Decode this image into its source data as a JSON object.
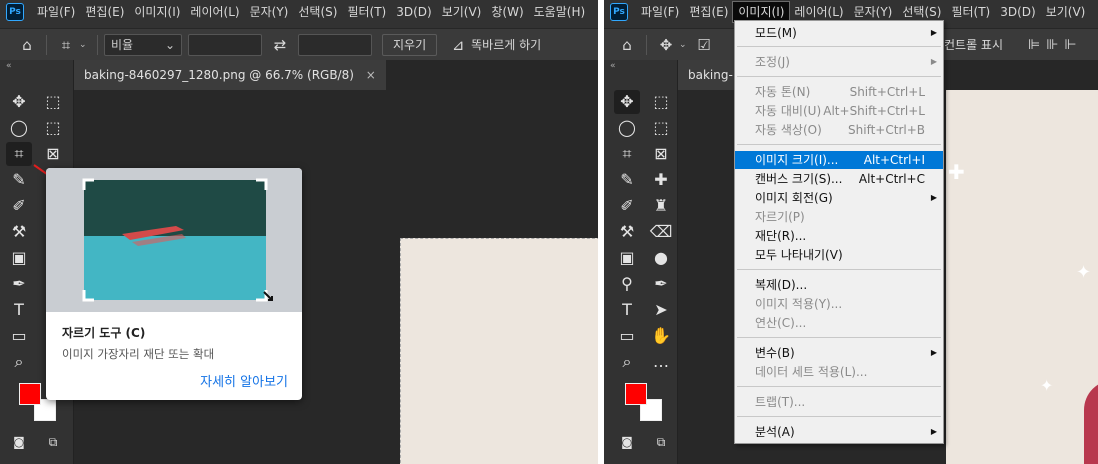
{
  "left": {
    "menu": [
      "파일(F)",
      "편집(E)",
      "이미지(I)",
      "레이어(L)",
      "문자(Y)",
      "선택(S)",
      "필터(T)",
      "3D(D)",
      "보기(V)",
      "창(W)",
      "도움말(H)"
    ],
    "options": {
      "ratio_label": "비율",
      "clear_button": "지우기",
      "straighten_label": "똑바르게 하기"
    },
    "doc_tab": "baking-8460297_1280.png @ 66.7% (RGB/8)",
    "tooltip": {
      "title": "자르기 도구 (C)",
      "description": "이미지 가장자리 재단 또는 확대",
      "link": "자세히 알아보기"
    }
  },
  "right": {
    "menu": [
      "파일(F)",
      "편집(E)",
      "이미지(I)",
      "레이어(L)",
      "문자(Y)",
      "선택(S)",
      "필터(T)",
      "3D(D)",
      "보기(V)"
    ],
    "options": {
      "show_controls_label": "컨트롤 표시"
    },
    "doc_tab": "baking-",
    "dropdown": [
      {
        "label": "모드(M)",
        "shortcut": "",
        "submenu": true,
        "disabled": false,
        "highlight": false
      },
      {
        "label": "조정(J)",
        "shortcut": "",
        "submenu": true,
        "disabled": true,
        "highlight": false
      },
      {
        "label": "자동 톤(N)",
        "shortcut": "Shift+Ctrl+L",
        "submenu": false,
        "disabled": true,
        "highlight": false
      },
      {
        "label": "자동 대비(U)",
        "shortcut": "Alt+Shift+Ctrl+L",
        "submenu": false,
        "disabled": true,
        "highlight": false
      },
      {
        "label": "자동 색상(O)",
        "shortcut": "Shift+Ctrl+B",
        "submenu": false,
        "disabled": true,
        "highlight": false
      },
      {
        "label": "이미지 크기(I)...",
        "shortcut": "Alt+Ctrl+I",
        "submenu": false,
        "disabled": false,
        "highlight": true
      },
      {
        "label": "캔버스 크기(S)...",
        "shortcut": "Alt+Ctrl+C",
        "submenu": false,
        "disabled": false,
        "highlight": false
      },
      {
        "label": "이미지 회전(G)",
        "shortcut": "",
        "submenu": true,
        "disabled": false,
        "highlight": false
      },
      {
        "label": "자르기(P)",
        "shortcut": "",
        "submenu": false,
        "disabled": true,
        "highlight": false
      },
      {
        "label": "재단(R)...",
        "shortcut": "",
        "submenu": false,
        "disabled": false,
        "highlight": false
      },
      {
        "label": "모두 나타내기(V)",
        "shortcut": "",
        "submenu": false,
        "disabled": false,
        "highlight": false
      },
      {
        "label": "복제(D)...",
        "shortcut": "",
        "submenu": false,
        "disabled": false,
        "highlight": false
      },
      {
        "label": "이미지 적용(Y)...",
        "shortcut": "",
        "submenu": false,
        "disabled": true,
        "highlight": false
      },
      {
        "label": "연산(C)...",
        "shortcut": "",
        "submenu": false,
        "disabled": true,
        "highlight": false
      },
      {
        "label": "변수(B)",
        "shortcut": "",
        "submenu": true,
        "disabled": false,
        "highlight": false
      },
      {
        "label": "데이터 세트 적용(L)...",
        "shortcut": "",
        "submenu": false,
        "disabled": true,
        "highlight": false
      },
      {
        "label": "트랩(T)...",
        "shortcut": "",
        "submenu": false,
        "disabled": true,
        "highlight": false
      },
      {
        "label": "분석(A)",
        "shortcut": "",
        "submenu": true,
        "disabled": false,
        "highlight": false
      }
    ]
  },
  "colors": {
    "foreground": "#ff0000",
    "background": "#ffffff",
    "highlight": "#0078d7",
    "link": "#1473e6"
  }
}
